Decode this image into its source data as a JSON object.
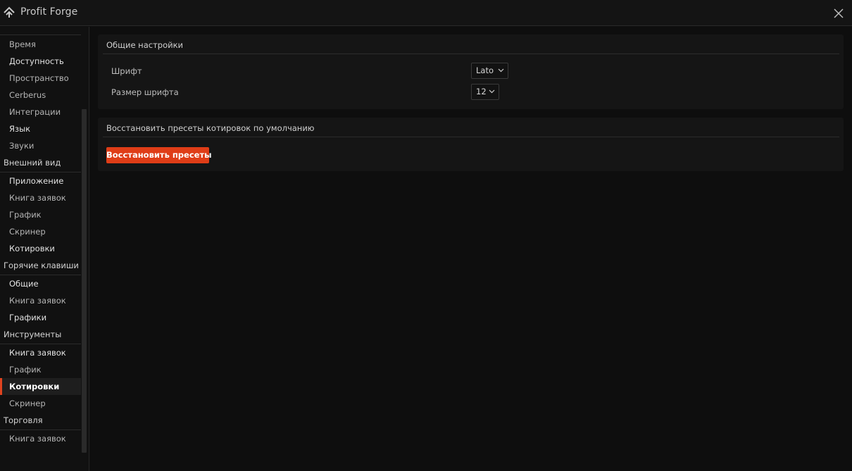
{
  "app": {
    "title": "Profit Forge"
  },
  "sidebar": {
    "items": [
      {
        "type": "item",
        "label": "Время",
        "tone": "normal"
      },
      {
        "type": "item",
        "label": "Доступность",
        "tone": "bright"
      },
      {
        "type": "item",
        "label": "Пространство",
        "tone": "normal"
      },
      {
        "type": "item",
        "label": "Cerberus",
        "tone": "normal"
      },
      {
        "type": "item",
        "label": "Интеграции",
        "tone": "normal"
      },
      {
        "type": "item",
        "label": "Язык",
        "tone": "bright"
      },
      {
        "type": "item",
        "label": "Звуки",
        "tone": "normal"
      },
      {
        "type": "header",
        "label": "Внешний вид"
      },
      {
        "type": "item",
        "label": "Приложение",
        "tone": "bright"
      },
      {
        "type": "item",
        "label": "Книга заявок",
        "tone": "normal"
      },
      {
        "type": "item",
        "label": "График",
        "tone": "normal"
      },
      {
        "type": "item",
        "label": "Скринер",
        "tone": "normal"
      },
      {
        "type": "item",
        "label": "Котировки",
        "tone": "bright"
      },
      {
        "type": "header",
        "label": "Горячие клавиши"
      },
      {
        "type": "item",
        "label": "Общие",
        "tone": "bright"
      },
      {
        "type": "item",
        "label": "Книга заявок",
        "tone": "normal"
      },
      {
        "type": "item",
        "label": "Графики",
        "tone": "bright"
      },
      {
        "type": "header",
        "label": "Инструменты"
      },
      {
        "type": "item",
        "label": "Книга заявок",
        "tone": "bright"
      },
      {
        "type": "item",
        "label": "График",
        "tone": "normal"
      },
      {
        "type": "item",
        "label": "Котировки",
        "tone": "active"
      },
      {
        "type": "item",
        "label": "Скринер",
        "tone": "normal"
      },
      {
        "type": "header",
        "label": "Торговля"
      },
      {
        "type": "item",
        "label": "Книга заявок",
        "tone": "normal"
      }
    ]
  },
  "general_settings": {
    "title": "Общие настройки",
    "font_label": "Шрифт",
    "font_value": "Lato",
    "font_size_label": "Размер шрифта",
    "font_size_value": "12"
  },
  "restore_section": {
    "title": "Восстановить пресеты котировок по умолчанию",
    "button_label": "Восстановить пресеты"
  },
  "colors": {
    "accent": "#df3d17",
    "background": "#0e0e0e",
    "panel": "#151515"
  }
}
